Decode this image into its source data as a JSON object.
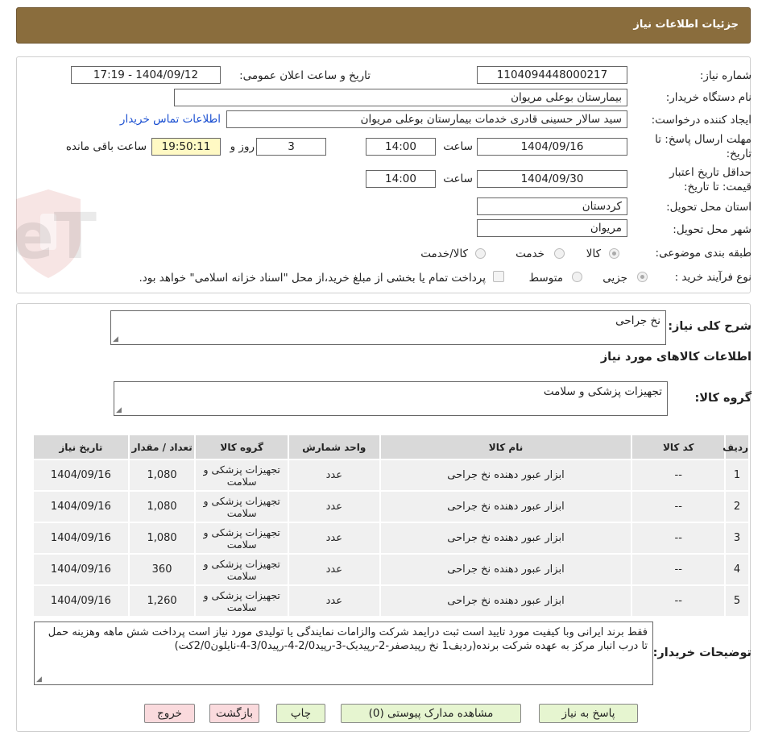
{
  "header": {
    "title": "جزئیات اطلاعات نیاز"
  },
  "colors": {
    "header_bg": "#8a6d3d",
    "link": "#1a4fd1",
    "highlight": "#fff9c4",
    "btn_green": "#e6f5d0",
    "btn_pink": "#fadadd"
  },
  "watermark": {
    "text": "AriaTender.neT"
  },
  "info": {
    "need_number_label": "شماره نیاز:",
    "need_number": "1104094448000217",
    "announce_label": "تاریخ و ساعت اعلان عمومی:",
    "announce_value": "1404/09/12 - 17:19",
    "buyer_org_label": "نام دستگاه خریدار:",
    "buyer_org": "بیمارستان بوعلی مریوان",
    "creator_label": "ایجاد کننده درخواست:",
    "creator": "سید سالار حسینی قادری خدمات بیمارستان بوعلی مریوان",
    "contact_link": "اطلاعات تماس خریدار",
    "deadline_label_1": "مهلت ارسال پاسخ: تا",
    "deadline_label_2": "تاریخ:",
    "deadline_date": "1404/09/16",
    "time_label": "ساعت",
    "deadline_time": "14:00",
    "days": "3",
    "day_and_label": "روز و",
    "remaining_time": "19:50:11",
    "remaining_label": "ساعت باقی مانده",
    "validity_label_1": "حداقل تاریخ اعتبار",
    "validity_label_2": "قیمت: تا تاریخ:",
    "validity_date": "1404/09/30",
    "validity_time": "14:00",
    "province_label": "استان محل تحویل:",
    "province": "کردستان",
    "city_label": "شهر محل تحویل:",
    "city": "مریوان",
    "category_label": "طبقه بندی موضوعی:",
    "category_options": [
      "کالا",
      "خدمت",
      "کالا/خدمت"
    ],
    "process_label": "نوع فرآیند خرید :",
    "process_options": [
      "جزیی",
      "متوسط"
    ],
    "payment_note": "پرداخت تمام یا بخشی از مبلغ خرید،از محل \"اسناد خزانه اسلامی\" خواهد بود."
  },
  "summary": {
    "general_desc_label": "شرح کلی نیاز:",
    "general_desc": "نخ جراحی",
    "items_title": "اطلاعات کالاهای مورد نیاز",
    "goods_group_label": "گروه کالا:",
    "goods_group": "تجهیزات پزشکی و سلامت"
  },
  "table": {
    "headers": [
      "ردیف",
      "کد کالا",
      "نام کالا",
      "واحد شمارش",
      "گروه کالا",
      "تعداد / مقدار",
      "تاریخ نیاز"
    ],
    "rows": [
      {
        "row": "1",
        "code": "--",
        "name": "ابزار عبور دهنده نخ جراحی",
        "unit": "عدد",
        "group": "تجهیزات پزشکی و سلامت",
        "qty": "1,080",
        "date": "1404/09/16"
      },
      {
        "row": "2",
        "code": "--",
        "name": "ابزار عبور دهنده نخ جراحی",
        "unit": "عدد",
        "group": "تجهیزات پزشکی و سلامت",
        "qty": "1,080",
        "date": "1404/09/16"
      },
      {
        "row": "3",
        "code": "--",
        "name": "ابزار عبور دهنده نخ جراحی",
        "unit": "عدد",
        "group": "تجهیزات پزشکی و سلامت",
        "qty": "1,080",
        "date": "1404/09/16"
      },
      {
        "row": "4",
        "code": "--",
        "name": "ابزار عبور دهنده نخ جراحی",
        "unit": "عدد",
        "group": "تجهیزات پزشکی و سلامت",
        "qty": "360",
        "date": "1404/09/16"
      },
      {
        "row": "5",
        "code": "--",
        "name": "ابزار عبور دهنده نخ جراحی",
        "unit": "عدد",
        "group": "تجهیزات پزشکی و سلامت",
        "qty": "1,260",
        "date": "1404/09/16"
      }
    ]
  },
  "buyer_notes": {
    "label": "توضیحات خریدار:",
    "text": "فقط برند ایرانی وبا کیفیت مورد تایید است ثبت درایمد شرکت والزامات نمایندگی یا تولیدی مورد نیاز است پرداخت شش ماهه وهزینه حمل تا درب انبار مرکز به عهده شرکت برنده(ردیف1 نخ رپیدصفر-2-رپیدیک-3-رپید2/0-4-رپید3/0-4-نایلون2/0کت)"
  },
  "buttons": {
    "reply": "پاسخ به نیاز",
    "attachments": "مشاهده مدارک پیوستی (0)",
    "print": "چاپ",
    "back": "بازگشت",
    "exit": "خروج"
  }
}
